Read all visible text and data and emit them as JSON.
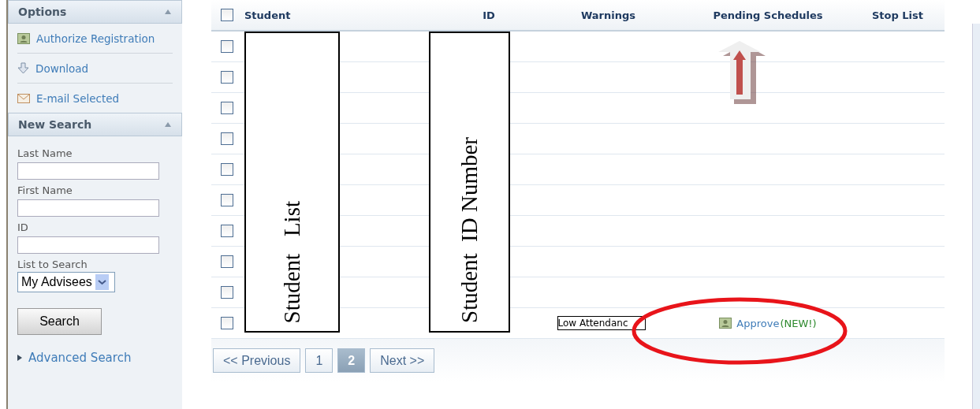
{
  "sidebar": {
    "options": {
      "title": "Options",
      "actions": [
        {
          "label": "Authorize Registration",
          "kind": "authorize"
        },
        {
          "label": "Download",
          "kind": "download"
        },
        {
          "label": "E-mail Selected",
          "kind": "email"
        }
      ]
    },
    "new_search": {
      "title": "New Search",
      "fields": [
        {
          "label": "Last Name"
        },
        {
          "label": "First Name"
        },
        {
          "label": "ID"
        }
      ],
      "list_label": "List to Search",
      "list_value": "My Advisees",
      "search_button": "Search",
      "advanced_link": "Advanced Search"
    }
  },
  "table": {
    "header_checked": false,
    "columns": [
      "Student",
      "ID",
      "Warnings",
      "Pending Schedules",
      "Stop List"
    ],
    "rows": [
      {
        "checked": false
      },
      {
        "checked": false
      },
      {
        "checked": false
      },
      {
        "checked": false
      },
      {
        "checked": false
      },
      {
        "checked": false
      },
      {
        "checked": false
      },
      {
        "checked": false
      },
      {
        "checked": false
      },
      {
        "checked": false,
        "warning": "Low Attendanc",
        "approve": "Approve",
        "approve_note": "(NEW!)"
      }
    ]
  },
  "annotations": {
    "student_box": "Student   List",
    "id_box": "Student  ID Number"
  },
  "pagination": {
    "previous": "<< Previous",
    "next": "Next >>",
    "pages": [
      {
        "label": "1",
        "selected": false
      },
      {
        "label": "2",
        "selected": true
      }
    ]
  }
}
